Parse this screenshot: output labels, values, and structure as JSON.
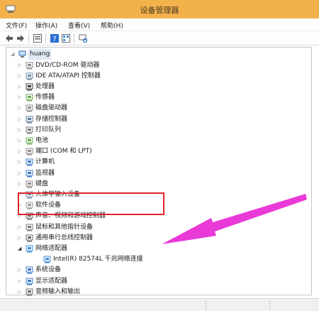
{
  "window": {
    "title": "设备管理器"
  },
  "menu": [
    "文件(F)",
    "操作(A)",
    "查看(V)",
    "帮助(H)"
  ],
  "toolbar": {
    "buttons": [
      "back-icon",
      "forward-icon",
      "properties-icon",
      "help-icon",
      "view-icon",
      "scan-hardware-icon"
    ]
  },
  "tree": {
    "root": "huang",
    "items": [
      {
        "label": "DVD/CD-ROM 驱动器",
        "icon": "dvd-drive-icon"
      },
      {
        "label": "IDE ATA/ATAPI 控制器",
        "icon": "ide-controller-icon"
      },
      {
        "label": "处理器",
        "icon": "processor-icon"
      },
      {
        "label": "传感器",
        "icon": "sensor-icon"
      },
      {
        "label": "磁盘驱动器",
        "icon": "disk-drive-icon"
      },
      {
        "label": "存储控制器",
        "icon": "storage-controller-icon"
      },
      {
        "label": "打印队列",
        "icon": "printer-icon"
      },
      {
        "label": "电池",
        "icon": "battery-icon"
      },
      {
        "label": "端口 (COM 和 LPT)",
        "icon": "port-icon"
      },
      {
        "label": "计算机",
        "icon": "computer-icon"
      },
      {
        "label": "监视器",
        "icon": "monitor-icon"
      },
      {
        "label": "键盘",
        "icon": "keyboard-icon"
      },
      {
        "label": "人体学输入设备",
        "icon": "hid-icon"
      },
      {
        "label": "软件设备",
        "icon": "software-device-icon"
      },
      {
        "label": "声音、视频和游戏控制器",
        "icon": "sound-icon"
      },
      {
        "label": "鼠标和其他指针设备",
        "icon": "mouse-icon"
      },
      {
        "label": "通用串行总线控制器",
        "icon": "usb-icon"
      },
      {
        "label": "网络适配器",
        "icon": "network-adapter-icon",
        "expanded": true
      },
      {
        "label": "Intel(R) 82574L 千兆网络连接",
        "icon": "network-card-icon",
        "child": true
      },
      {
        "label": "系统设备",
        "icon": "system-device-icon"
      },
      {
        "label": "显示适配器",
        "icon": "display-adapter-icon"
      },
      {
        "label": "音频输入和输出",
        "icon": "audio-io-icon"
      }
    ]
  },
  "colors": {
    "titlebar": "#f3b14c",
    "highlight": "#e0252b",
    "arrow": "#e82fd6"
  }
}
